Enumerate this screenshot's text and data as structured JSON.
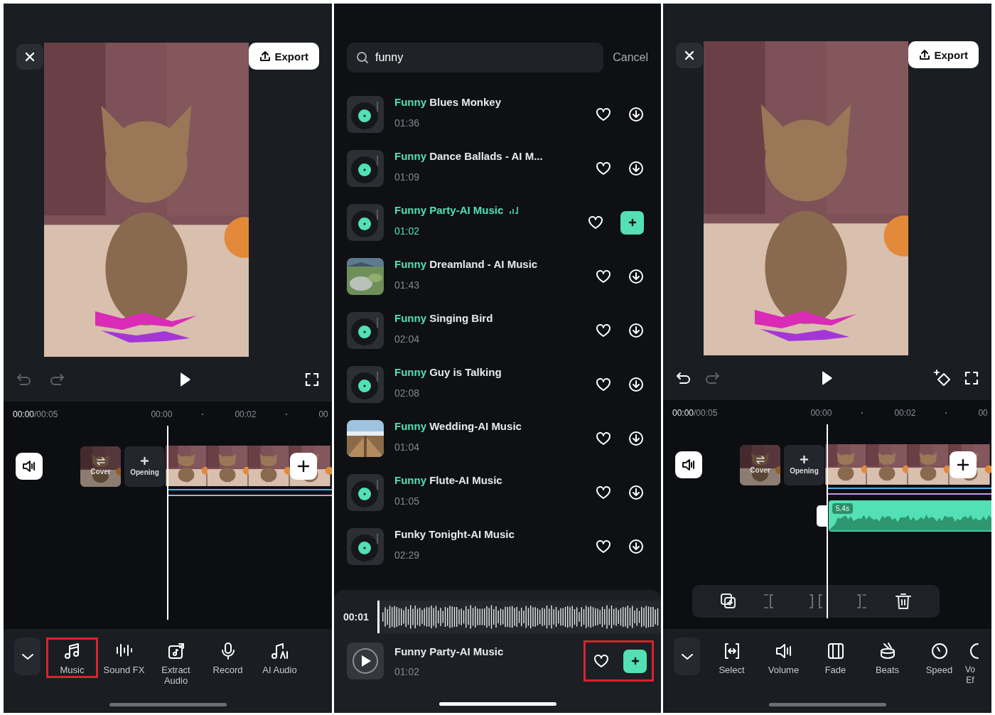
{
  "screens": [
    {
      "kind": "editor",
      "export_button": "Export",
      "undo_enabled": false,
      "redo_enabled": false,
      "keyframe_button": false,
      "time_current": "00:00",
      "time_total": "/00:05",
      "ruler": [
        "00:00",
        "00:02",
        "00"
      ],
      "track": {
        "cover": "Cover",
        "opening": "Opening"
      },
      "tools": [
        {
          "kind": "music",
          "label": "Music",
          "highlighted": true
        },
        {
          "kind": "sound-fx",
          "label": "Sound FX",
          "highlighted": false
        },
        {
          "kind": "extract",
          "label": "Extract Audio",
          "highlighted": false
        },
        {
          "kind": "record",
          "label": "Record",
          "highlighted": false
        },
        {
          "kind": "ai-audio",
          "label": "AI Audio",
          "highlighted": false
        }
      ]
    },
    {
      "kind": "search",
      "search": {
        "value": "funny"
      },
      "cancel": "Cancel",
      "tracks": [
        {
          "kind": "vinyl",
          "title_match": "Funny",
          "title": " Blues Monkey",
          "duration": "01:36",
          "selected": false
        },
        {
          "kind": "vinyl",
          "title_match": "Funny",
          "title": " Dance Ballads - AI M...",
          "duration": "01:09",
          "selected": false
        },
        {
          "kind": "vinyl",
          "title_match": "Funny",
          "title": " Party-AI Music",
          "duration": "01:02",
          "selected": true
        },
        {
          "kind": "picture",
          "title_match": "Funny",
          "title": " Dreamland - AI Music",
          "duration": "01:43",
          "selected": false
        },
        {
          "kind": "vinyl",
          "title_match": "Funny",
          "title": " Singing Bird",
          "duration": "02:04",
          "selected": false
        },
        {
          "kind": "vinyl",
          "title_match": "Funny",
          "title": " Guy is Talking",
          "duration": "02:08",
          "selected": false
        },
        {
          "kind": "picture",
          "title_match": "Funny",
          "title": " Wedding-AI Music",
          "duration": "01:04",
          "selected": false
        },
        {
          "kind": "vinyl",
          "title_match": "Funny",
          "title": " Flute-AI Music",
          "duration": "01:05",
          "selected": false
        },
        {
          "kind": "vinyl",
          "title": "Funky Tonight-AI Music",
          "duration": "02:29",
          "selected": false
        }
      ],
      "player": {
        "time": "00:01",
        "title": "Funny Party-AI Music",
        "duration": "01:02",
        "highlighted": true
      }
    },
    {
      "kind": "editor",
      "export_button": "Export",
      "undo_enabled": true,
      "redo_enabled": false,
      "keyframe_button": true,
      "time_current": "00:00",
      "time_total": "/00:05",
      "ruler": [
        "00:00",
        "00:02",
        "00"
      ],
      "track": {
        "cover": "Cover",
        "opening": "Opening"
      },
      "audio_clip": {
        "duration": "5.4s"
      },
      "clip_tools": [
        {
          "kind": "duplicate",
          "disabled": false
        },
        {
          "kind": "split-left",
          "disabled": true
        },
        {
          "kind": "split",
          "disabled": true
        },
        {
          "kind": "split-right",
          "disabled": true
        },
        {
          "kind": "delete",
          "disabled": false
        }
      ],
      "tools": [
        {
          "kind": "select",
          "label": "Select",
          "highlighted": false
        },
        {
          "kind": "volume",
          "label": "Volume",
          "highlighted": false
        },
        {
          "kind": "fade",
          "label": "Fade",
          "highlighted": false
        },
        {
          "kind": "beats",
          "label": "Beats",
          "highlighted": false
        },
        {
          "kind": "speed",
          "label": "Speed",
          "highlighted": false
        },
        {
          "kind": "voice-effect",
          "label": "Vo Ef",
          "highlighted": false
        }
      ]
    }
  ]
}
